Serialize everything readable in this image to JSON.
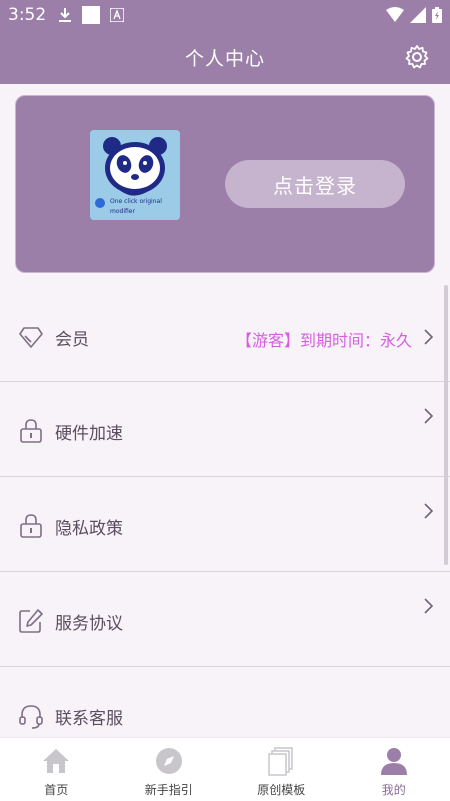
{
  "status_bar": {
    "time": "3:52"
  },
  "header": {
    "title": "个人中心"
  },
  "profile": {
    "avatar_text_line1": "One click original",
    "avatar_text_line2": "modifier",
    "login_label": "点击登录"
  },
  "menu": {
    "items": [
      {
        "label": "会员",
        "icon": "diamond-icon",
        "status": "【游客】到期时间：永久"
      },
      {
        "label": "硬件加速",
        "icon": "lock-icon"
      },
      {
        "label": "隐私政策",
        "icon": "lock-icon"
      },
      {
        "label": "服务协议",
        "icon": "edit-icon"
      },
      {
        "label": "联系客服",
        "icon": "headset-icon"
      }
    ]
  },
  "tabs": [
    {
      "label": "首页",
      "icon": "home-icon",
      "active": false
    },
    {
      "label": "新手指引",
      "icon": "compass-icon",
      "active": false
    },
    {
      "label": "原创模板",
      "icon": "pages-icon",
      "active": false
    },
    {
      "label": "我的",
      "icon": "user-icon",
      "active": true
    }
  ],
  "colors": {
    "primary": "#9b7fa9",
    "login_button": "#c6b3cd",
    "vip_text": "#d65fe0",
    "page_bg": "#f7f3f8"
  }
}
